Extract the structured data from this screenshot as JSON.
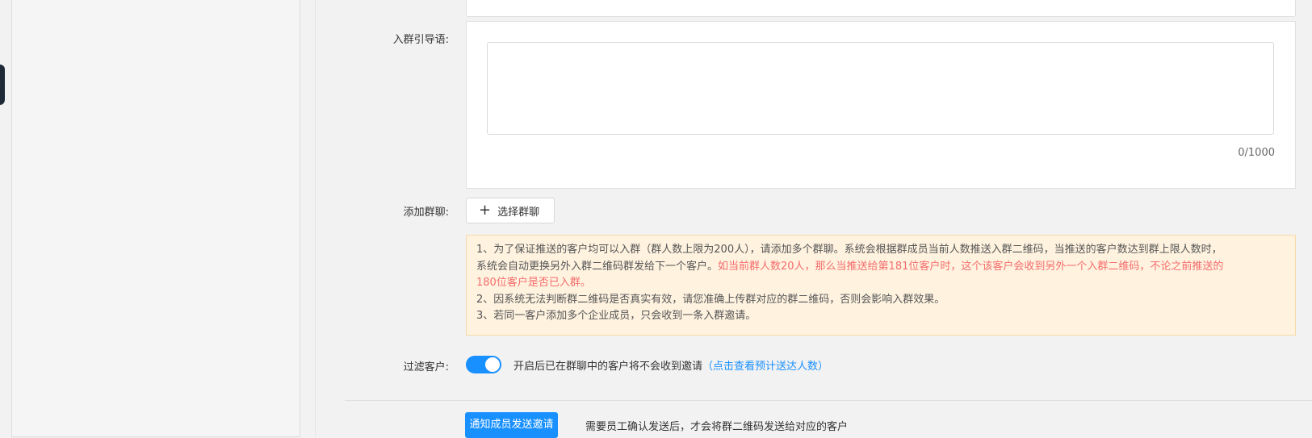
{
  "sidebar": {
    "collapse_icon": "chevron-left-icon",
    "collapse_glyph": "‹"
  },
  "form": {
    "intro_label": "入群引导语:",
    "intro_value": "",
    "intro_count": "0/1000",
    "add_group_label": "添加群聊:",
    "select_group_button": "选择群聊",
    "notice": {
      "line1": "1、为了保证推送的客户均可以入群（群人数上限为200人），请添加多个群聊。系统会根据群成员当前人数推送入群二维码，当推送的客户数达到群上限人数时，",
      "line2_normal": "系统会自动更换另外入群二维码群发给下一个客户。",
      "line2_red": "如当前群人数20人，那么当推送给第181位客户时，这个该客户会收到另外一个入群二维码，不论之前推送的",
      "line3_red": "180位客户是否已入群。",
      "line4": "2、因系统无法判断群二维码是否真实有效，请您准确上传群对应的群二维码，否则会影响入群效果。",
      "line5": "3、若同一客户添加多个企业成员，只会收到一条入群邀请。"
    },
    "filter_label": "过滤客户:",
    "filter_enabled": true,
    "filter_text": "开启后已在群聊中的客户将不会收到邀请",
    "filter_link": "（点击查看预计送达人数）",
    "notify_button": "通知成员发送邀请",
    "notify_hint": "需要员工确认发送后，才会将群二维码发送给对应的客户"
  },
  "colors": {
    "primary": "#1890ff",
    "warning_bg": "#fff3e0",
    "danger_text": "#f56c6c"
  }
}
